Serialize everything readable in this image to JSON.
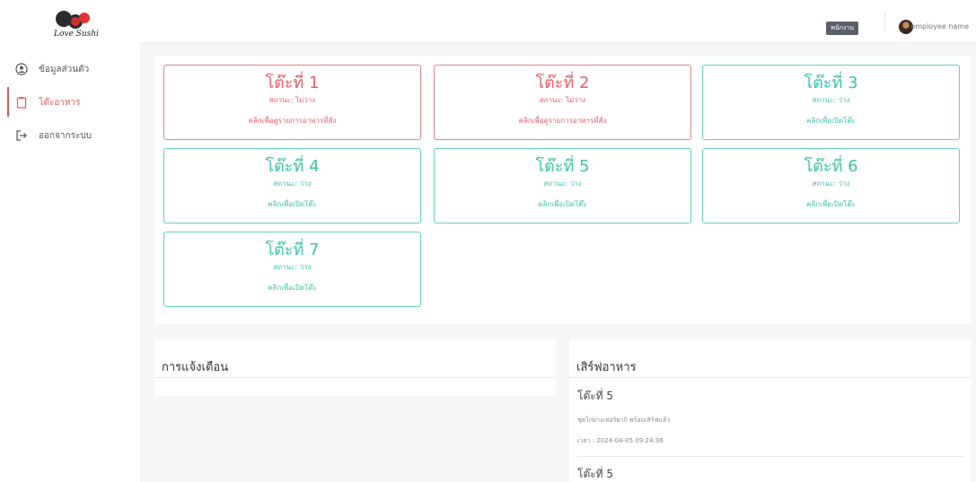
{
  "brand": {
    "logo_text": "Love Sushi"
  },
  "sidebar": {
    "items": [
      {
        "label": "ข้อมูลส่วนตัว",
        "icon": "user-circle-icon"
      },
      {
        "label": "โต๊ะอาหาร",
        "icon": "clipboard-icon",
        "active": true
      },
      {
        "label": "ออกจากระบบ",
        "icon": "logout-icon"
      }
    ]
  },
  "topbar": {
    "role": "พนักงาน",
    "user_name": "employee name"
  },
  "tables": [
    {
      "title": "โต๊ะที่ 1",
      "status": "สถานะ: ไม่ว่าง",
      "action": "คลิกเพื่อดูรายการอาหารที่สั่ง",
      "state": "busy"
    },
    {
      "title": "โต๊ะที่ 2",
      "status": "สถานะ: ไม่ว่าง",
      "action": "คลิกเพื่อดูรายการอาหารที่สั่ง",
      "state": "busy"
    },
    {
      "title": "โต๊ะที่ 3",
      "status": "สถานะ: ว่าง",
      "action": "คลิกเพื่อเปิดโต๊ะ",
      "state": "free"
    },
    {
      "title": "โต๊ะที่ 4",
      "status": "สถานะ: ว่าง",
      "action": "คลิกเพื่อเปิดโต๊ะ",
      "state": "free"
    },
    {
      "title": "โต๊ะที่ 5",
      "status": "สถานะ: ว่าง",
      "action": "คลิกเพื่อเปิดโต๊ะ",
      "state": "free"
    },
    {
      "title": "โต๊ะที่ 6",
      "status": "สถานะ: ว่าง",
      "action": "คลิกเพื่อเปิดโต๊ะ",
      "state": "free"
    },
    {
      "title": "โต๊ะที่ 7",
      "status": "สถานะ: ว่าง",
      "action": "คลิกเพื่อเปิดโต๊ะ",
      "state": "free"
    }
  ],
  "notifications": {
    "title": "การแจ้งเตือน"
  },
  "serve": {
    "title": "เสิร์ฟอาหาร",
    "items": [
      {
        "table": "โต๊ะที่ 5",
        "detail": "ชุดไก่ย่างเทอริยากิ พร้อมเสิร์ฟแล้ว",
        "time": "เวลา : 2024-04-05 09:24:36"
      },
      {
        "table": "โต๊ะที่ 5"
      }
    ]
  },
  "colors": {
    "busy": "#ea5b6a",
    "free": "#3cc4a6",
    "active_nav": "#e05a5a"
  }
}
